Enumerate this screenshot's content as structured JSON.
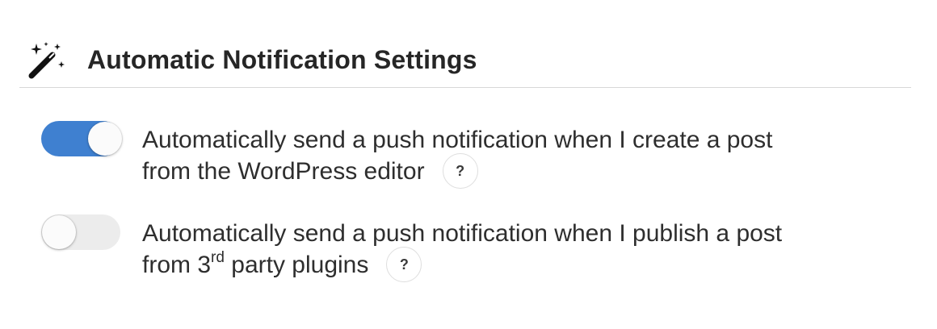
{
  "header": {
    "title": "Automatic Notification Settings",
    "icon": "magic-wand-icon"
  },
  "settings": [
    {
      "enabled": true,
      "label_line1": "Automatically send a push notification when I create a post",
      "label_line2": "from the WordPress editor",
      "help": "?"
    },
    {
      "enabled": false,
      "label_line1": "Automatically send a push notification when I publish a post",
      "label_line2_pre": "from 3",
      "label_line2_sup": "rd",
      "label_line2_post": " party plugins",
      "help": "?"
    }
  ],
  "colors": {
    "toggle_on": "#3f80d0",
    "toggle_off": "#ececec",
    "divider": "#d8d8d8"
  }
}
